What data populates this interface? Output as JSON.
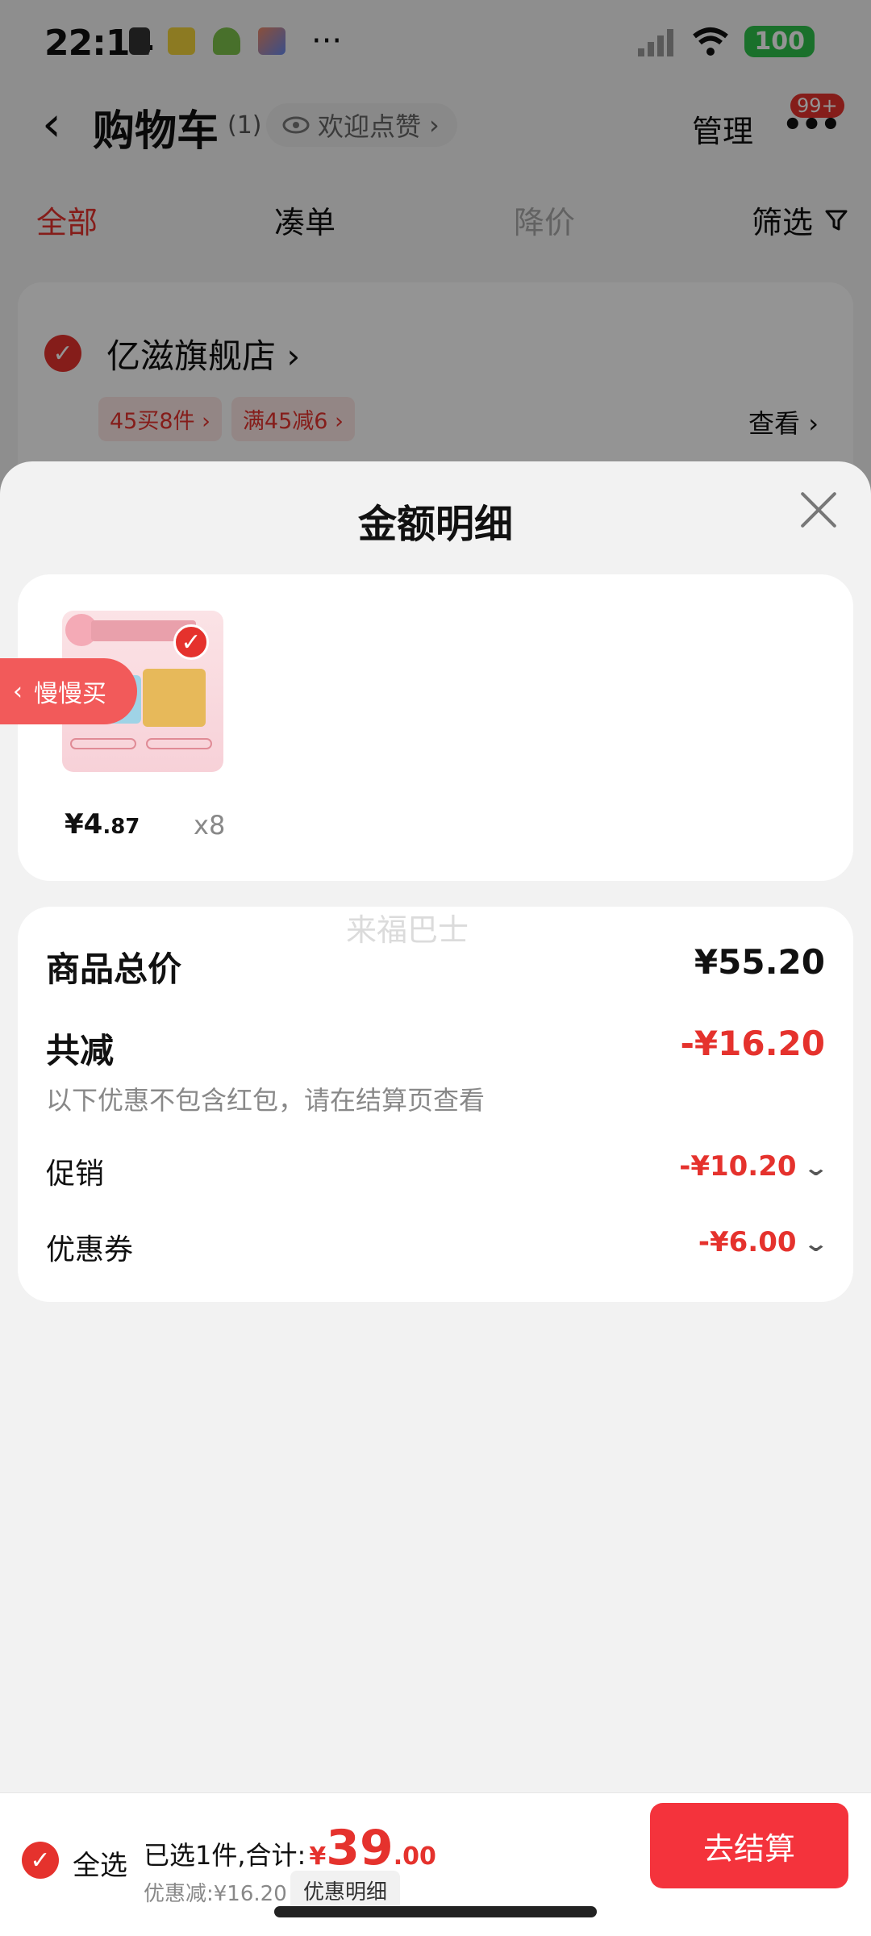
{
  "status_bar": {
    "time": "22:14",
    "battery": "100",
    "more": "···"
  },
  "nav": {
    "back_icon": "chevron-left-icon",
    "title": "购物车",
    "count": "(1)",
    "like_label": "欢迎点赞",
    "manage": "管理",
    "badge": "99+"
  },
  "tabs": [
    {
      "label": "全部",
      "state": "active"
    },
    {
      "label": "凑单",
      "state": "normal"
    },
    {
      "label": "降价",
      "state": "disabled"
    },
    {
      "label": "筛选",
      "state": "normal"
    }
  ],
  "store": {
    "name": "亿滋旗舰店",
    "promos": [
      "45买8件",
      "满45减6"
    ],
    "view": "查看"
  },
  "sheet": {
    "title": "金额明细",
    "item": {
      "price_main": "¥4",
      "price_cents": ".87",
      "qty": "x8"
    },
    "slow_buy": "慢慢买",
    "watermark": "来福巴士",
    "summary": {
      "total_label": "商品总价",
      "total_value": "¥55.20",
      "reduce_label": "共减",
      "reduce_value": "-¥16.20",
      "note": "以下优惠不包含红包，请在结算页查看",
      "promo_label": "促销",
      "promo_value": "-¥10.20",
      "coupon_label": "优惠券",
      "coupon_value": "-¥6.00"
    }
  },
  "bottom_bar": {
    "select_all": "全选",
    "selected_text": "已选1件,合计:",
    "currency": "¥",
    "total_int": "39",
    "total_dec": ".00",
    "discount": "优惠减:¥16.20",
    "detail_button": "优惠明细",
    "checkout": "去结算"
  },
  "colors": {
    "accent": "#e5322d",
    "checkout": "#f4333c",
    "battery": "#2ec24a"
  }
}
